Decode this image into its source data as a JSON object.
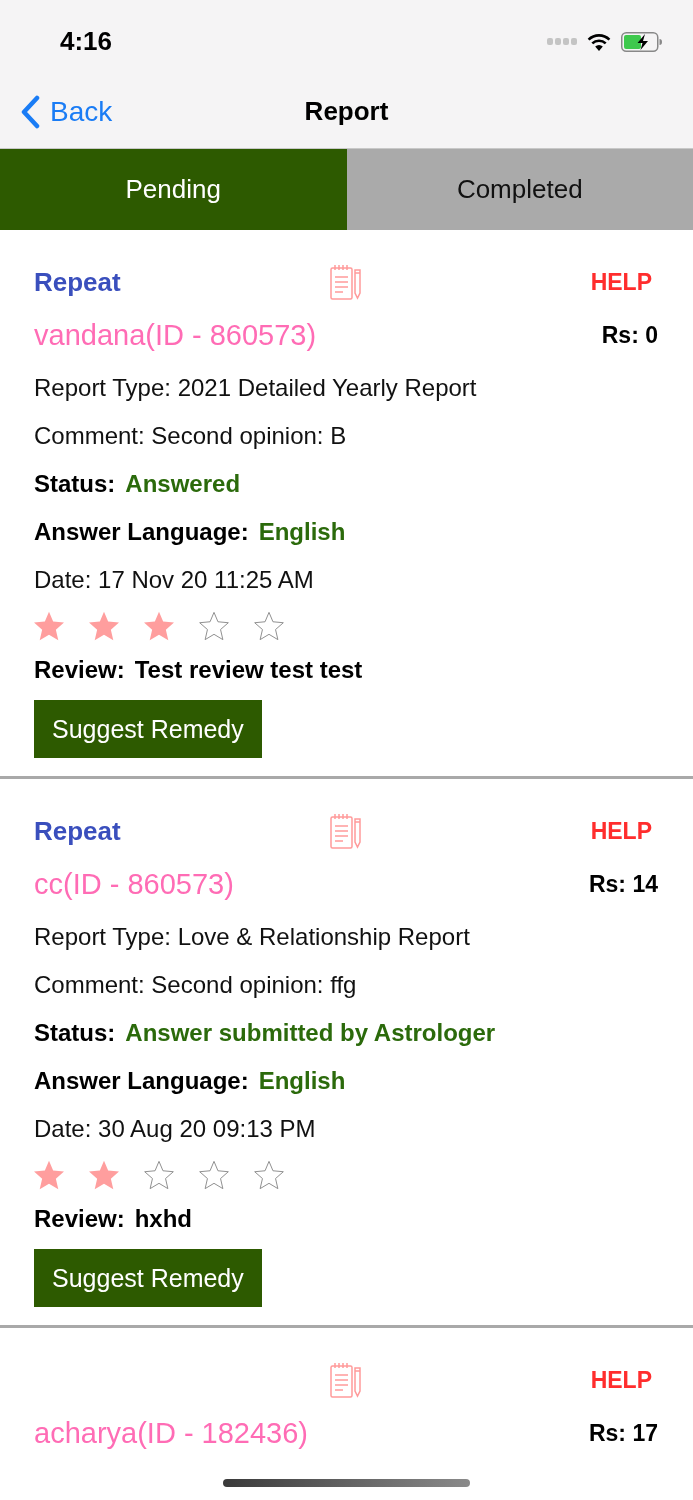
{
  "status_bar": {
    "time": "4:16"
  },
  "nav_bar": {
    "back": "Back",
    "title": "Report"
  },
  "tabs": [
    {
      "label": "Pending",
      "selected": true
    },
    {
      "label": "Completed",
      "selected": false
    }
  ],
  "cards": [
    {
      "repeat": "Repeat",
      "help": "HELP",
      "name": "vandana(ID - 860573)",
      "amount": "Rs: 0",
      "report_type": "Report Type: 2021 Detailed Yearly Report",
      "comment": "Comment: Second opinion: B",
      "status": {
        "label": "Status:",
        "value": "Answered"
      },
      "answer_language": {
        "label": "Answer Language:",
        "value": "English"
      },
      "date": "Date: 17 Nov 20 11:25 AM",
      "stars": 3,
      "review": {
        "label": "Review:",
        "value": "Test review test test"
      },
      "button": "Suggest Remedy"
    },
    {
      "repeat": "Repeat",
      "help": "HELP",
      "name": "cc(ID - 860573)",
      "amount": "Rs: 14",
      "report_type": "Report Type: Love & Relationship Report",
      "comment": "Comment: Second opinion: ffg",
      "status": {
        "label": "Status:",
        "value": "Answer submitted by Astrologer"
      },
      "answer_language": {
        "label": "Answer Language:",
        "value": "English"
      },
      "date": "Date: 30 Aug 20 09:13 PM",
      "stars": 2,
      "review": {
        "label": "Review:",
        "value": "hxhd"
      },
      "button": "Suggest Remedy"
    },
    {
      "help": "HELP",
      "name": "acharya(ID - 182436)",
      "amount": "Rs: 17"
    }
  ]
}
